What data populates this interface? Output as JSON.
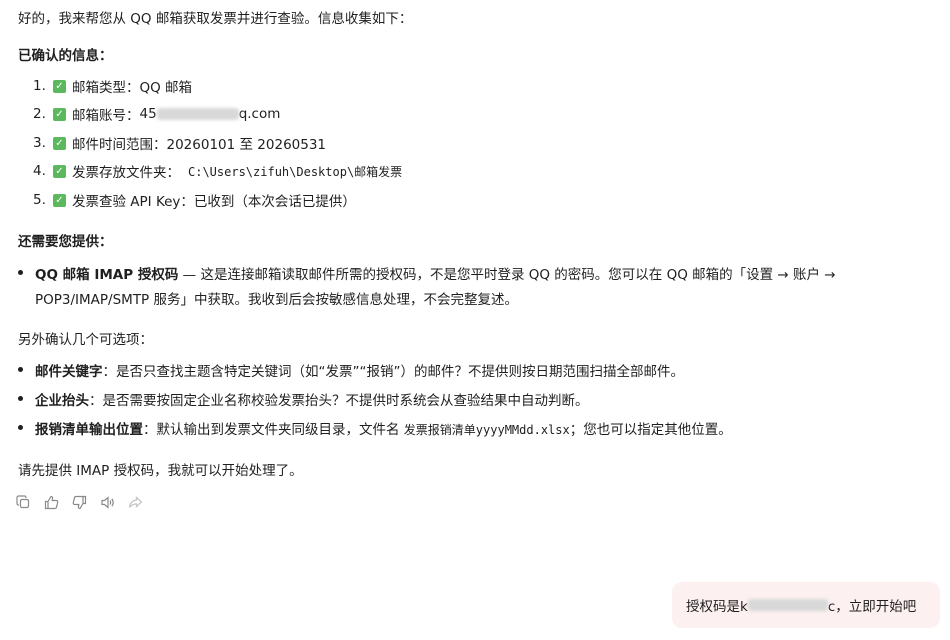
{
  "intro": "好的，我来帮您从 QQ 邮箱获取发票并进行查验。信息收集如下：",
  "confirmed": {
    "heading": "已确认的信息：",
    "items": [
      {
        "num": "1.",
        "label": "邮箱类型：",
        "value": "QQ 邮箱"
      },
      {
        "num": "2.",
        "label": "邮箱账号：",
        "value_prefix": "45",
        "value_suffix": "q.com"
      },
      {
        "num": "3.",
        "label": "邮件时间范围：",
        "value": "20260101 至 20260531"
      },
      {
        "num": "4.",
        "label": "发票存放文件夹：",
        "value": "C:\\Users\\zifuh\\Desktop\\邮箱发票"
      },
      {
        "num": "5.",
        "label": "发票查验 API Key：",
        "value": "已收到（本次会话已提供）"
      }
    ]
  },
  "needed": {
    "heading": "还需要您提供：",
    "item_bold": "QQ 邮箱 IMAP 授权码",
    "item_text_1": " — 这是连接邮箱读取邮件所需的授权码，不是您平时登录 QQ 的密码。您可以在 QQ 邮箱的「设置 → 账户 →",
    "item_text_2": "POP3/IMAP/SMTP 服务」中获取。我收到后会按敏感信息处理，不会完整复述。"
  },
  "optional": {
    "heading": "另外确认几个可选项：",
    "items": [
      {
        "bold": "邮件关键字",
        "text": "：是否只查找主题含特定关键词（如“发票”“报销”）的邮件？不提供则按日期范围扫描全部邮件。"
      },
      {
        "bold": "企业抬头",
        "text": "：是否需要按固定企业名称校验发票抬头？不提供时系统会从查验结果中自动判断。"
      },
      {
        "bold": "报销清单输出位置",
        "text_before": "：默认输出到发票文件夹同级目录，文件名 ",
        "code": "发票报销清单yyyyMMdd.xlsx",
        "text_after": "；您也可以指定其他位置。"
      }
    ]
  },
  "closing": "请先提供 IMAP 授权码，我就可以开始处理了。",
  "user_message": {
    "prefix": "授权码是k",
    "suffix": "c，立即开始吧"
  },
  "actions": [
    "copy-icon",
    "thumbs-up-icon",
    "thumbs-down-icon",
    "speaker-icon",
    "share-icon"
  ]
}
